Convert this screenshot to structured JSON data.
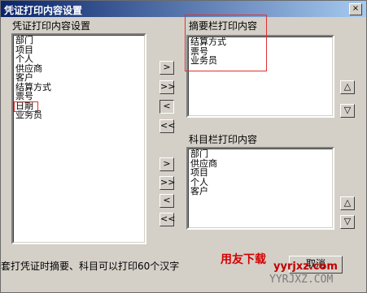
{
  "window": {
    "title": "凭证打印内容设置",
    "close_glyph": "×"
  },
  "left_panel": {
    "heading": "凭证打印内容设置",
    "items": [
      "部门",
      "项目",
      "个人",
      "供应商",
      "客户",
      "结算方式",
      "票号",
      "日期",
      "业务员"
    ]
  },
  "summary_panel": {
    "heading": "摘要栏打印内容",
    "items": [
      "结算方式",
      "票号",
      "业务员"
    ]
  },
  "subject_panel": {
    "heading": "科目栏打印内容",
    "items": [
      "部门",
      "供应商",
      "项目",
      "个人",
      "客户"
    ]
  },
  "move_buttons": {
    "right": ">",
    "all_right": ">>",
    "left": "<",
    "all_left": "<<"
  },
  "order_buttons": {
    "up": "△",
    "down": "▽"
  },
  "footer": {
    "note": "套打凭证时摘要、科目可以打印60个汉字",
    "cancel_label": "取消"
  },
  "watermark": {
    "text": "用友下载",
    "url": "yyrjxz.com",
    "url_caps": "YYRJXZ.COM"
  },
  "colors": {
    "highlight": "#e03030",
    "title_bar_start": "#0a246a",
    "title_bar_end": "#a6caf0"
  }
}
